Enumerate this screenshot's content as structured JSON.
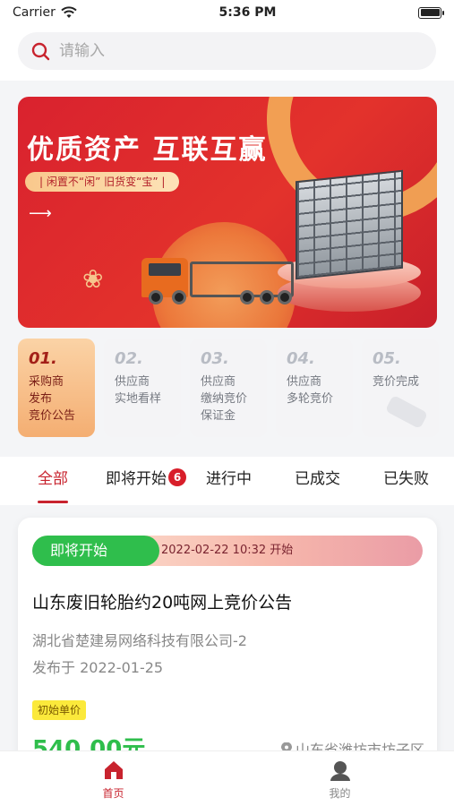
{
  "status_bar": {
    "carrier": "Carrier",
    "time": "5:36 PM"
  },
  "search": {
    "placeholder": "请输入"
  },
  "banner": {
    "title": "优质资产  互联互赢",
    "subtitle": "|  闲置不“闲”    旧货变“宝”  |",
    "arrow": "⟶"
  },
  "steps": [
    {
      "num": "01.",
      "lines": [
        "采购商",
        "发布",
        "竞价公告"
      ],
      "active": true
    },
    {
      "num": "02.",
      "lines": [
        "供应商",
        "实地看样"
      ],
      "active": false
    },
    {
      "num": "03.",
      "lines": [
        "供应商",
        "缴纳竞价",
        "保证金"
      ],
      "active": false
    },
    {
      "num": "04.",
      "lines": [
        "供应商",
        "多轮竞价"
      ],
      "active": false
    },
    {
      "num": "05.",
      "lines": [
        "竞价完成"
      ],
      "active": false
    }
  ],
  "tabs": [
    {
      "label": "全部",
      "active": true
    },
    {
      "label": "即将开始",
      "badge": "6"
    },
    {
      "label": "进行中"
    },
    {
      "label": "已成交"
    },
    {
      "label": "已失败"
    }
  ],
  "card": {
    "status": "即将开始",
    "start_time": "2022-02-22 10:32 开始",
    "title": "山东废旧轮胎约20吨网上竞价公告",
    "company": "湖北省楚建易网络科技有限公司-2",
    "published": "发布于 2022-01-25",
    "price_label": "初始单价",
    "price": "540.00元",
    "location": "山东省潍坊市坊子区"
  },
  "bottom_nav": [
    {
      "label": "首页",
      "icon": "home-icon",
      "active": true
    },
    {
      "label": "我的",
      "icon": "profile-icon",
      "active": false
    }
  ],
  "colors": {
    "accent": "#c8232e",
    "green": "#2fbe4c",
    "banner_red": "#d9222e"
  }
}
